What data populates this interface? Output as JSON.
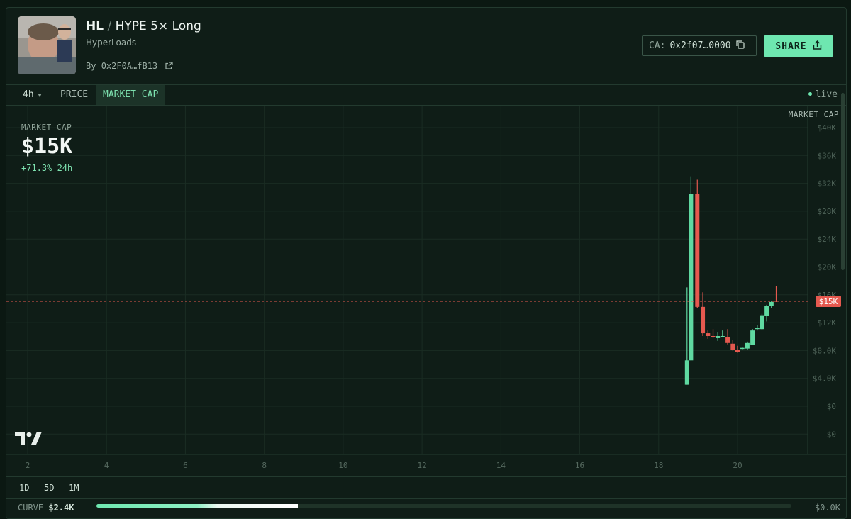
{
  "token": {
    "ticker": "HL",
    "name": "HYPE 5× Long",
    "project": "HyperLoads",
    "by_label": "By",
    "creator": "0x2F0A…fB13"
  },
  "actions": {
    "ca_label": "CA:",
    "ca_value": "0x2f07…0000",
    "share_label": "SHARE"
  },
  "toolbar": {
    "interval": "4h",
    "price_tab": "PRICE",
    "mcap_tab": "MARKET CAP",
    "live_label": "live"
  },
  "stats": {
    "label": "MARKET CAP",
    "value": "$15K",
    "change": "+71.3% 24h"
  },
  "range": {
    "buttons": [
      "1D",
      "5D",
      "1M"
    ]
  },
  "curve": {
    "label": "CURVE",
    "value": "$2.4K",
    "right_value": "$0.0K",
    "progress": 0.29
  },
  "chart_data": {
    "type": "candlestick",
    "y_axis_title": "MARKET CAP",
    "y_ticks": [
      "$40K",
      "$36K",
      "$32K",
      "$28K",
      "$24K",
      "$20K",
      "$16K",
      "$12K",
      "$8.0K",
      "$4.0K",
      "$0",
      "$0"
    ],
    "x_ticks": [
      "2",
      "4",
      "6",
      "8",
      "10",
      "12",
      "14",
      "16",
      "18",
      "20"
    ],
    "last_value_label": "$15K",
    "last_value": 15000,
    "colors": {
      "up": "#5fd9a1",
      "down": "#e5594f",
      "grid": "#1a2c23",
      "background": "#0f1d17"
    },
    "candles": [
      {
        "x": 18.72,
        "o": 3000,
        "h": 17000,
        "l": 3000,
        "c": 6500
      },
      {
        "x": 18.82,
        "o": 6500,
        "h": 33000,
        "l": 6500,
        "c": 30500
      },
      {
        "x": 18.98,
        "o": 30500,
        "h": 32500,
        "l": 14000,
        "c": 14200
      },
      {
        "x": 19.12,
        "o": 14200,
        "h": 16300,
        "l": 10000,
        "c": 10400
      },
      {
        "x": 19.25,
        "o": 10400,
        "h": 10800,
        "l": 9600,
        "c": 10000
      },
      {
        "x": 19.38,
        "o": 10000,
        "h": 11000,
        "l": 9700,
        "c": 9800
      },
      {
        "x": 19.5,
        "o": 9700,
        "h": 10600,
        "l": 9300,
        "c": 10000
      },
      {
        "x": 19.62,
        "o": 10000,
        "h": 10800,
        "l": 9900,
        "c": 10000
      },
      {
        "x": 19.75,
        "o": 9800,
        "h": 11000,
        "l": 8800,
        "c": 9000
      },
      {
        "x": 19.88,
        "o": 8900,
        "h": 9400,
        "l": 7900,
        "c": 8000
      },
      {
        "x": 20.0,
        "o": 8000,
        "h": 8600,
        "l": 7600,
        "c": 7700
      },
      {
        "x": 20.12,
        "o": 8200,
        "h": 8400,
        "l": 8000,
        "c": 8300
      },
      {
        "x": 20.25,
        "o": 8200,
        "h": 9200,
        "l": 8000,
        "c": 9000
      },
      {
        "x": 20.38,
        "o": 8700,
        "h": 11000,
        "l": 8700,
        "c": 10800
      },
      {
        "x": 20.5,
        "o": 11000,
        "h": 11600,
        "l": 10800,
        "c": 11200
      },
      {
        "x": 20.62,
        "o": 11000,
        "h": 13200,
        "l": 10900,
        "c": 13000
      },
      {
        "x": 20.74,
        "o": 12900,
        "h": 14500,
        "l": 12100,
        "c": 14300
      },
      {
        "x": 20.86,
        "o": 14300,
        "h": 15000,
        "l": 14000,
        "c": 14900
      },
      {
        "x": 20.98,
        "o": 15100,
        "h": 17200,
        "l": 14900,
        "c": 15000
      }
    ]
  }
}
